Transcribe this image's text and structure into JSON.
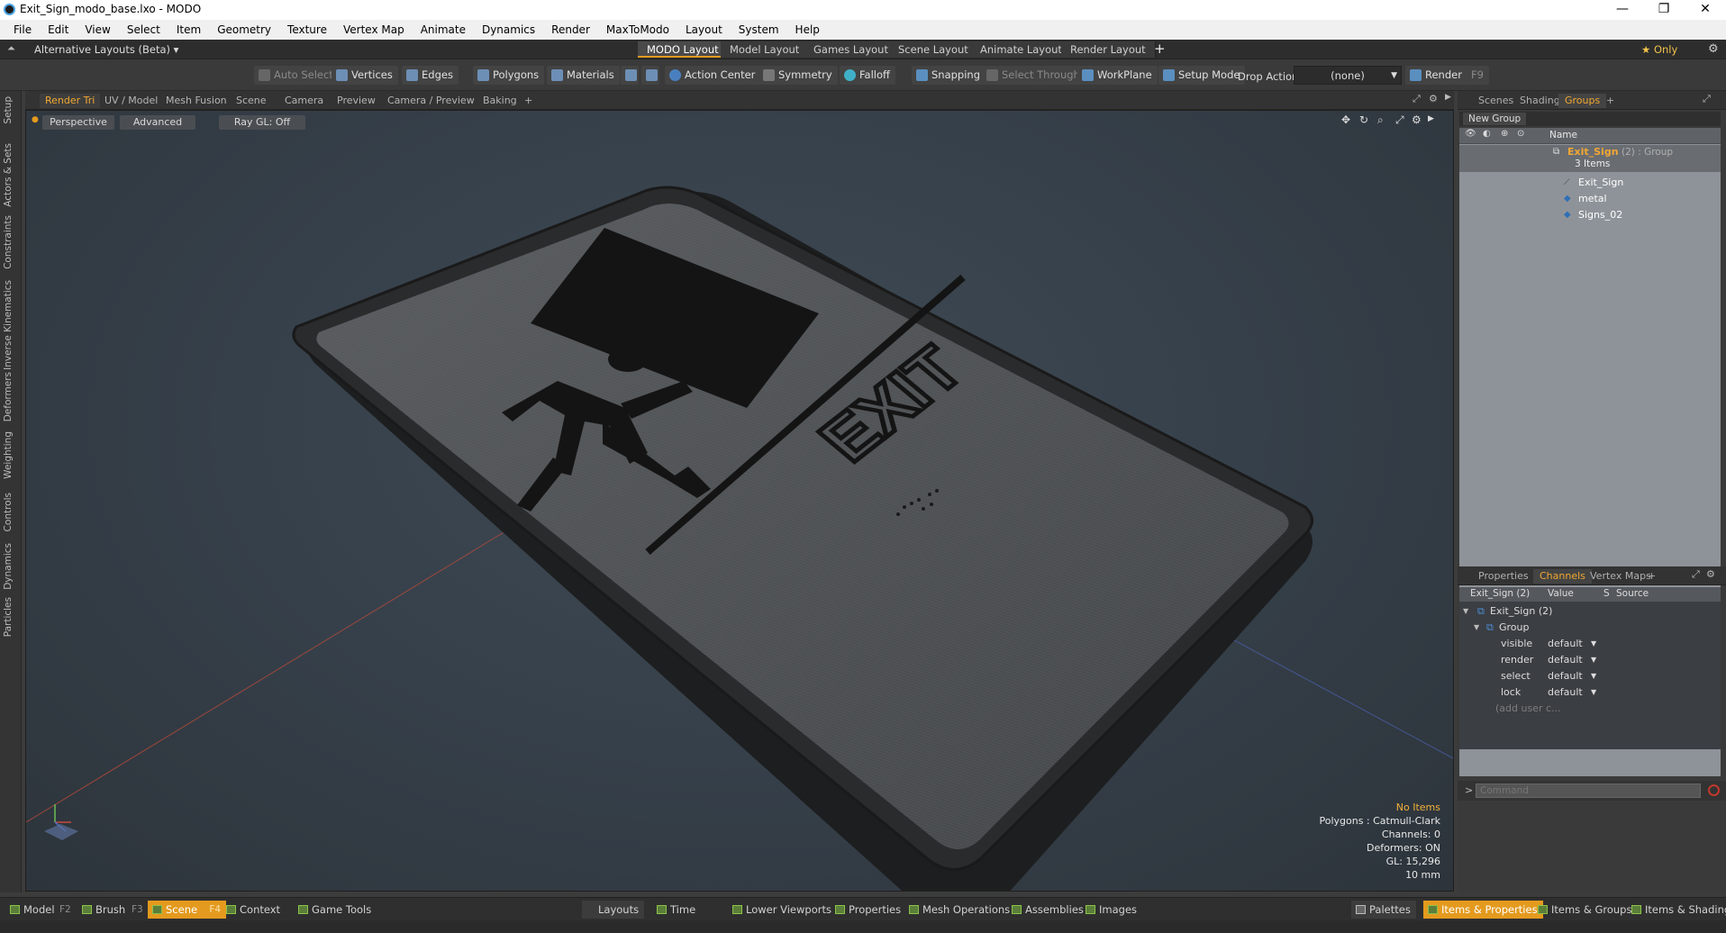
{
  "window": {
    "title": "Exit_Sign_modo_base.lxo - MODO",
    "controls": [
      "—",
      "❐",
      "✕"
    ]
  },
  "menubar": [
    "File",
    "Edit",
    "View",
    "Select",
    "Item",
    "Geometry",
    "Texture",
    "Vertex Map",
    "Animate",
    "Dynamics",
    "Render",
    "MaxToModo",
    "Layout",
    "System",
    "Help"
  ],
  "layoutbar": {
    "alt_layouts": "Alternative Layouts (Beta) ▾",
    "tabs": [
      "MODO Layout",
      "Model Layout",
      "Games Layout",
      "Scene Layout",
      "Animate Layout",
      "Render Layout"
    ],
    "active_tab": "MODO Layout",
    "add": "+",
    "only": "★  Only"
  },
  "toolbar": {
    "auto_select": "Auto Select",
    "vertices": "Vertices",
    "edges": "Edges",
    "polygons": "Polygons",
    "materials": "Materials",
    "action_center": "Action Center",
    "symmetry": "Symmetry",
    "falloff": "Falloff",
    "snapping": "Snapping",
    "select_through": "Select Through",
    "workplane": "WorkPlane",
    "setup_mode": "Setup Mode",
    "drop_action_label": "Drop Action",
    "drop_action_value": "(none)",
    "render": "Render",
    "render_key": "F9"
  },
  "left_tabs": [
    "Setup",
    "Actors & Sets",
    "Constraints",
    "Inverse Kinematics",
    "Deformers",
    "Weighting",
    "Controls",
    "Dynamics",
    "Particles"
  ],
  "viewport_tabs": [
    "Render Tri",
    "UV / Model",
    "Mesh Fusion",
    "Scene",
    "Camera",
    "Preview",
    "Camera / Preview",
    "Baking",
    "+"
  ],
  "viewport_active_tab": "Render Tri",
  "viewport_sub": {
    "view": "Perspective",
    "mode": "Advanced",
    "raygl": "Ray GL: Off"
  },
  "sign_text": "EXIT",
  "stats": {
    "items": "No Items",
    "polygons": "Polygons : Catmull-Clark",
    "channels": "Channels: 0",
    "deformers": "Deformers: ON",
    "gl": "GL: 15,296",
    "scale": "10 mm"
  },
  "scenes_panel": {
    "tabs": [
      "Scenes",
      "Shading",
      "Groups",
      "+"
    ],
    "active_tab": "Groups",
    "new_group": "New Group",
    "name_header": "Name",
    "group": {
      "name": "Exit_Sign",
      "suffix": "(2) : Group",
      "count": "3 Items"
    },
    "children": [
      "Exit_Sign",
      "metal",
      "Signs_02"
    ]
  },
  "channels_panel": {
    "tabs": [
      "Properties",
      "Channels",
      "Vertex Maps",
      "+"
    ],
    "active_tab": "Channels",
    "headers": {
      "name": "Exit_Sign (2)",
      "value": "Value",
      "s": "S",
      "source": "Source"
    },
    "root": "Exit_Sign (2)",
    "group": "Group",
    "rows": [
      {
        "name": "visible",
        "value": "default"
      },
      {
        "name": "render",
        "value": "default"
      },
      {
        "name": "select",
        "value": "default"
      },
      {
        "name": "lock",
        "value": "default"
      }
    ],
    "add_user": "(add user c..."
  },
  "command": {
    "prompt": ">",
    "placeholder": "Command"
  },
  "bottombar": {
    "left": [
      {
        "label": "Model",
        "key": "F2"
      },
      {
        "label": "Brush",
        "key": "F3"
      },
      {
        "label": "Scene",
        "key": "F4"
      },
      {
        "label": "Context",
        "key": ""
      },
      {
        "label": "Game Tools",
        "key": ""
      }
    ],
    "active": "Scene",
    "middle": [
      "Layouts",
      "Time",
      "Lower Viewports",
      "Properties",
      "Mesh Operations",
      "Assemblies",
      "Images"
    ],
    "right": [
      "Palettes",
      "Items & Properties",
      "Items & Groups",
      "Items & Shading"
    ],
    "right_active": "Items & Properties"
  },
  "colors": {
    "accent": "#e49a1e",
    "panel": "#3a3a3a",
    "viewport": "#3a444d"
  }
}
